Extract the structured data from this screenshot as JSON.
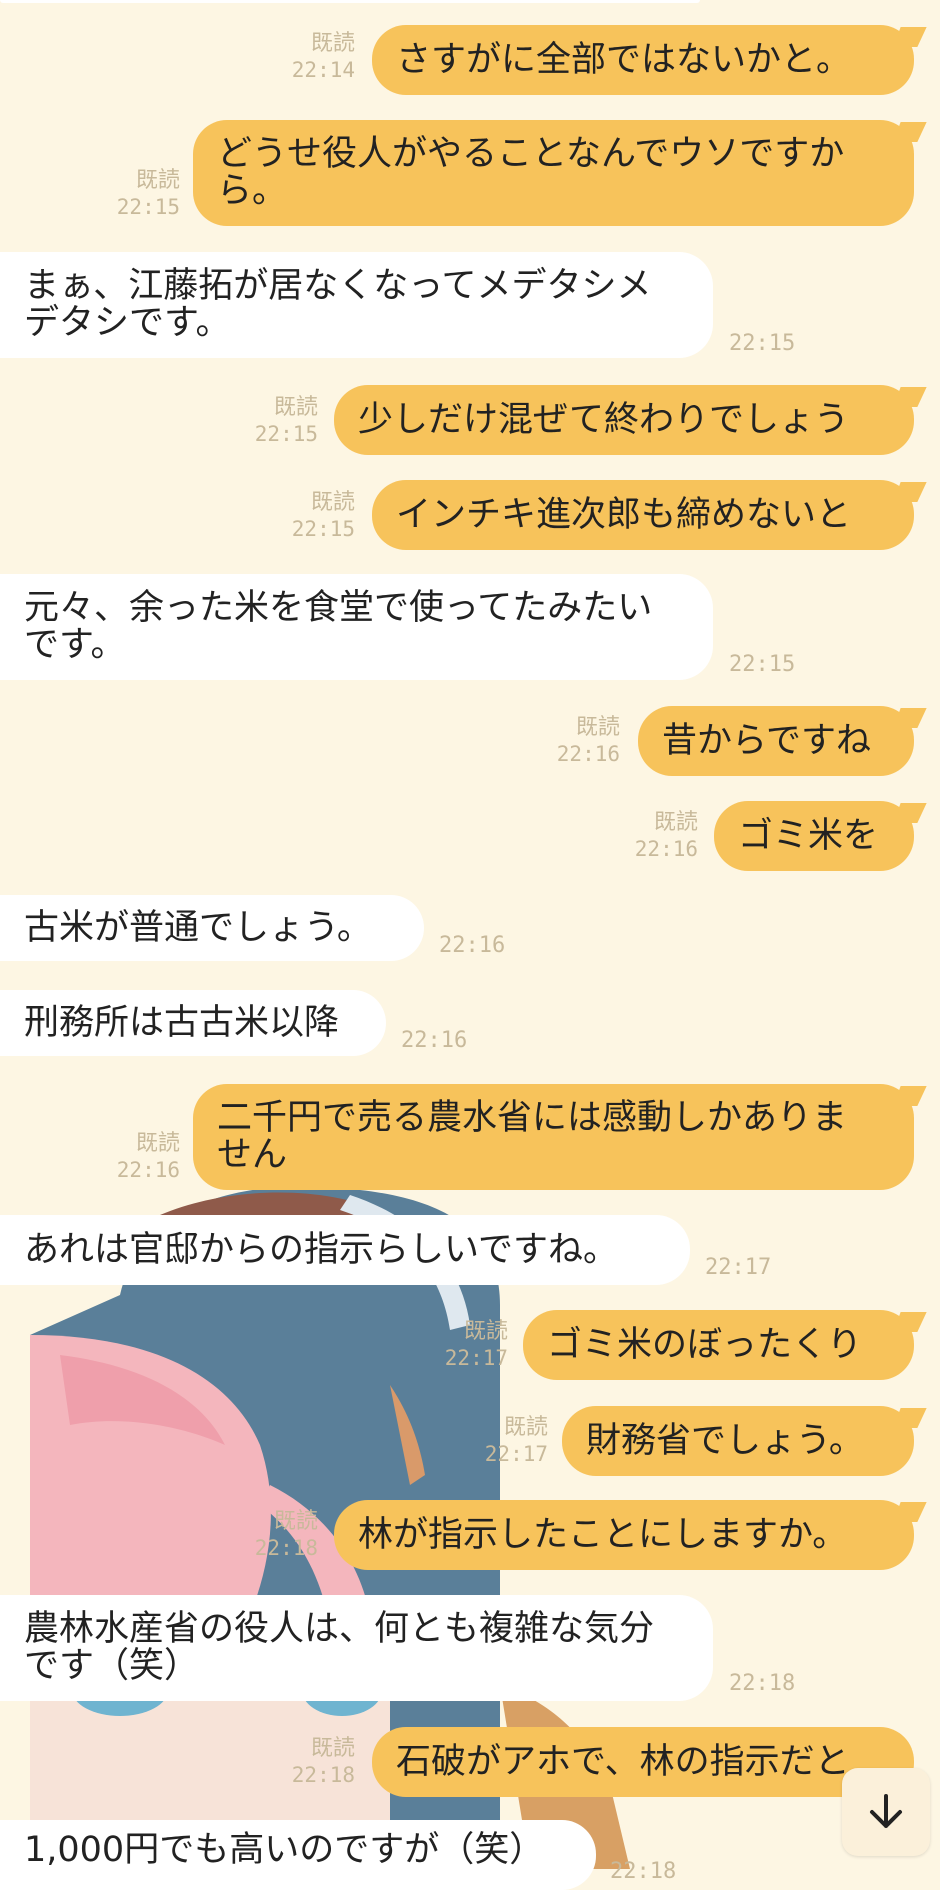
{
  "messages": [
    {
      "dir": "out",
      "text": "さすがに全部ではないかと。",
      "read": "既読",
      "time": "22:14"
    },
    {
      "dir": "out",
      "text": "どうせ役人がやることなんでウソですから。",
      "read": "既読",
      "time": "22:15"
    },
    {
      "dir": "in",
      "text": "まぁ、江藤拓が居なくなってメデタシメデタシです。",
      "time": "22:15"
    },
    {
      "dir": "out",
      "text": "少しだけ混ぜて終わりでしょう",
      "read": "既読",
      "time": "22:15"
    },
    {
      "dir": "out",
      "text": "インチキ進次郎も締めないと",
      "read": "既読",
      "time": "22:15"
    },
    {
      "dir": "in",
      "text": "元々、余った米を食堂で使ってたみたいです。",
      "time": "22:15"
    },
    {
      "dir": "out",
      "text": "昔からですね",
      "read": "既読",
      "time": "22:16"
    },
    {
      "dir": "out",
      "text": "ゴミ米を",
      "read": "既読",
      "time": "22:16"
    },
    {
      "dir": "in",
      "text": "古米が普通でしょう。",
      "time": "22:16"
    },
    {
      "dir": "in",
      "text": "刑務所は古古米以降",
      "time": "22:16"
    },
    {
      "dir": "out",
      "text": "二千円で売る農水省には感動しかありません",
      "read": "既読",
      "time": "22:16"
    },
    {
      "dir": "in",
      "text": "あれは官邸からの指示らしいですね。",
      "time": "22:17"
    },
    {
      "dir": "out",
      "text": "ゴミ米のぼったくり",
      "read": "既読",
      "time": "22:17"
    },
    {
      "dir": "out",
      "text": "財務省でしょう。",
      "read": "既読",
      "time": "22:17"
    },
    {
      "dir": "out",
      "text": "林が指示したことにしますか。",
      "read": "既読",
      "time": "22:18"
    },
    {
      "dir": "in",
      "text": "農林水産省の役人は、何とも複雑な気分です（笑）",
      "time": "22:18"
    },
    {
      "dir": "out",
      "text": "石破がアホで、林の指示だと",
      "read": "既読",
      "time": "22:18"
    },
    {
      "dir": "in",
      "text": "1,000円でも高いのですが（笑）",
      "time": "22:18"
    }
  ],
  "scroll_button": {
    "icon": "arrow-down-icon"
  }
}
